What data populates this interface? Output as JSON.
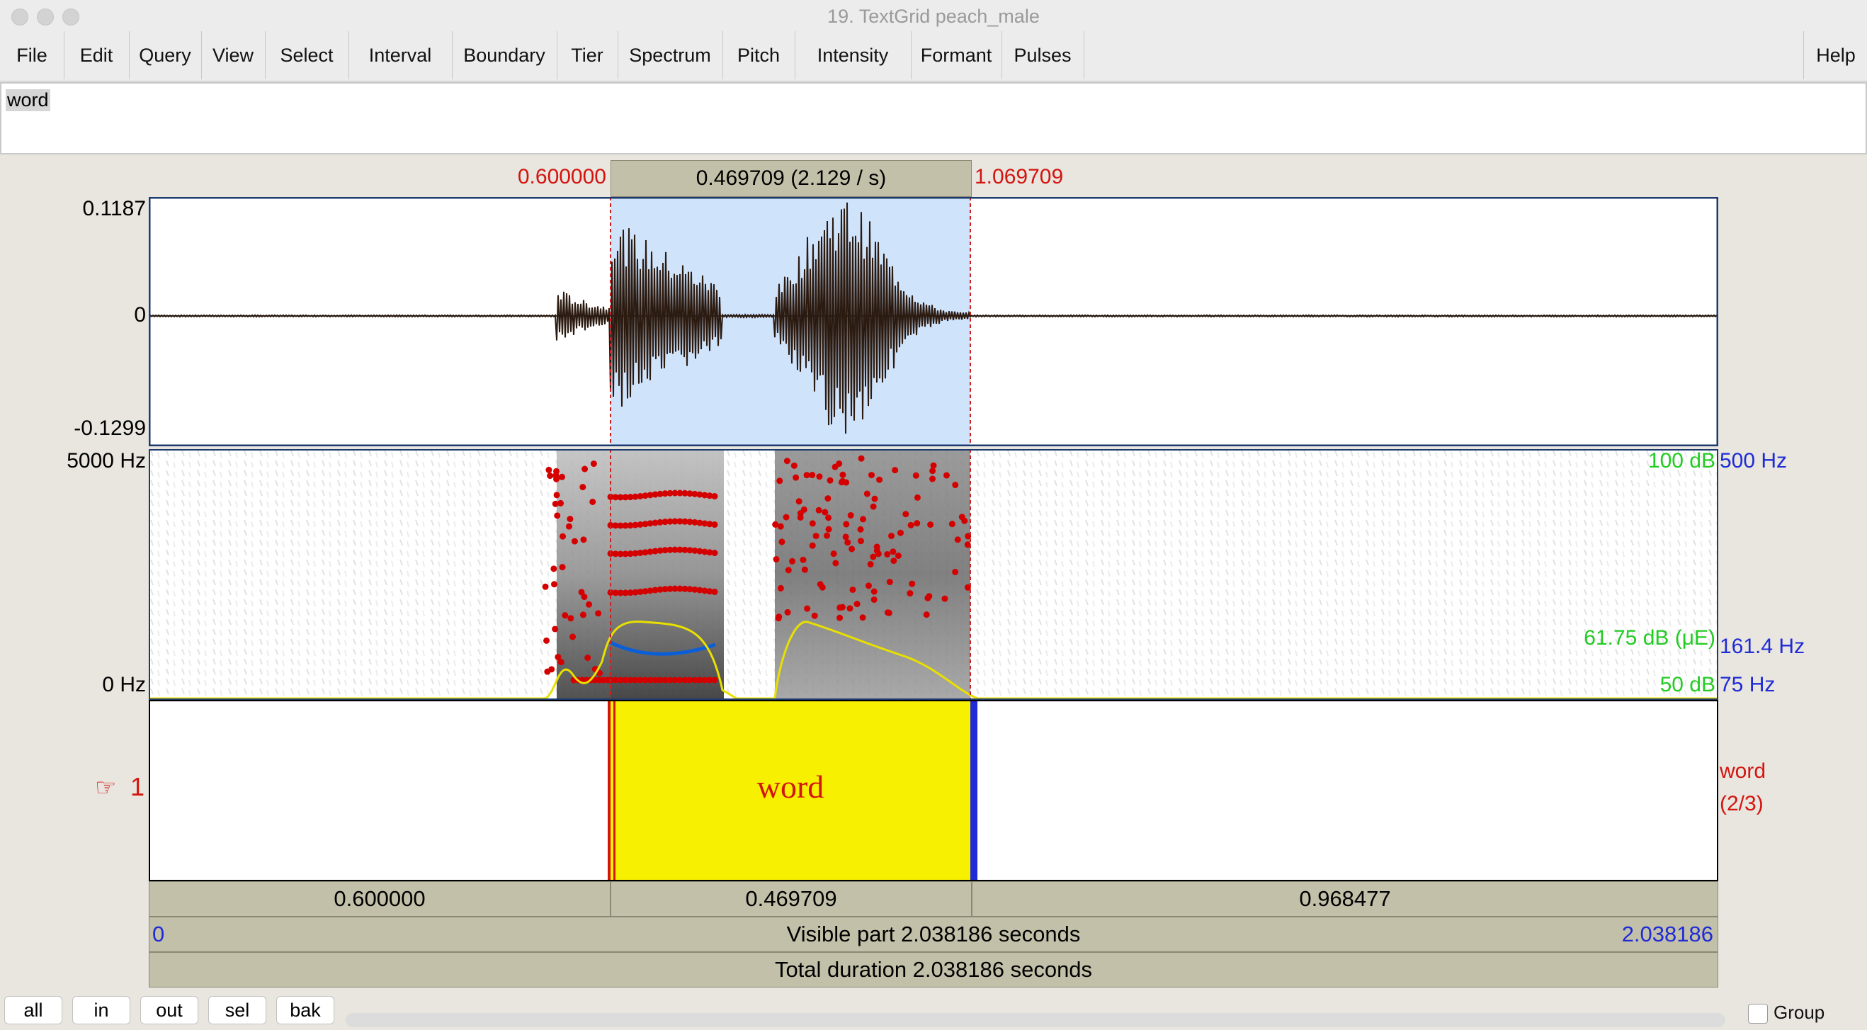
{
  "window": {
    "title": "19. TextGrid peach_male"
  },
  "menu": [
    "File",
    "Edit",
    "Query",
    "View",
    "Select",
    "Interval",
    "Boundary",
    "Tier",
    "Spectrum",
    "Pitch",
    "Intensity",
    "Formant",
    "Pulses"
  ],
  "help_label": "Help",
  "text_field": {
    "value": "word"
  },
  "selection": {
    "start": "0.600000",
    "duration": "0.469709 (2.129 / s)",
    "end": "1.069709"
  },
  "waveform": {
    "ymax": "0.1187",
    "yzero": "0",
    "ymin": "-0.1299"
  },
  "spectrogram": {
    "freq_top": "5000 Hz",
    "freq_bottom": "0 Hz",
    "intensity_top": "100 dB",
    "intensity_mid": "61.75 dB (μE)",
    "intensity_bottom": "50 dB",
    "pitch_top": "500 Hz",
    "pitch_mid": "161.4 Hz",
    "pitch_bottom": "75 Hz"
  },
  "tier": {
    "pointer_icon": "pointing-hand-icon",
    "pointer_glyph": "☞",
    "number": "1",
    "interval_text": "word",
    "right_name": "word",
    "right_count": "(2/3)"
  },
  "durations": {
    "left": "0.600000",
    "mid": "0.469709",
    "right": "0.968477"
  },
  "visible": {
    "start": "0",
    "label": "Visible part 2.038186 seconds",
    "end": "2.038186"
  },
  "total": {
    "label": "Total duration 2.038186 seconds"
  },
  "nav_buttons": [
    "all",
    "in",
    "out",
    "sel",
    "bak"
  ],
  "group_label": "Group",
  "colors": {
    "selection_fill": "#cfe3fb",
    "interval_fill": "#f7f000",
    "red": "#d4140f",
    "green": "#22cc22",
    "blue": "#1f2bd6",
    "formant": "#d40000",
    "pitch": "#0a5fd8",
    "intensity": "#e8e000"
  }
}
